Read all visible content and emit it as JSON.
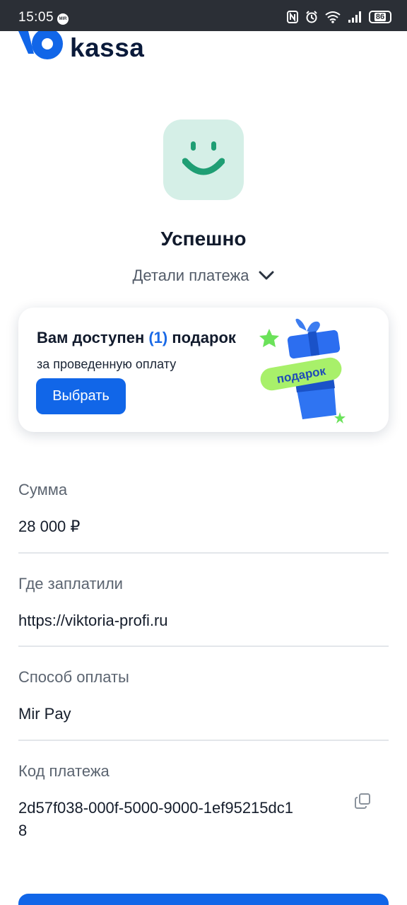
{
  "status_bar": {
    "time": "15:05",
    "badge": "MIR",
    "battery": "86"
  },
  "logo": {
    "text": "kassa"
  },
  "result": {
    "title": "Успешно",
    "details_label": "Детали платежа"
  },
  "promo": {
    "title_prefix": "Вам доступен",
    "count": "(1)",
    "title_suffix": "подарок",
    "subtitle": "за проведенную оплату",
    "button_label": "Выбрать",
    "gift_tag": "подарок"
  },
  "payment": {
    "amount_label": "Сумма",
    "amount_value": "28 000 ₽",
    "where_label": "Где заплатили",
    "where_value": "https://viktoria-profi.ru",
    "method_label": "Способ оплаты",
    "method_value": "Mir Pay",
    "code_label": "Код платежа",
    "code_value_line1": "2d57f038-000f-5000-9000-1ef95215dc1",
    "code_value_line2": "8"
  },
  "colors": {
    "accent": "#1166e8",
    "success_tile": "#d5efe7",
    "success_icon": "#1f9e74",
    "gift_tag": "#a8f06a"
  }
}
